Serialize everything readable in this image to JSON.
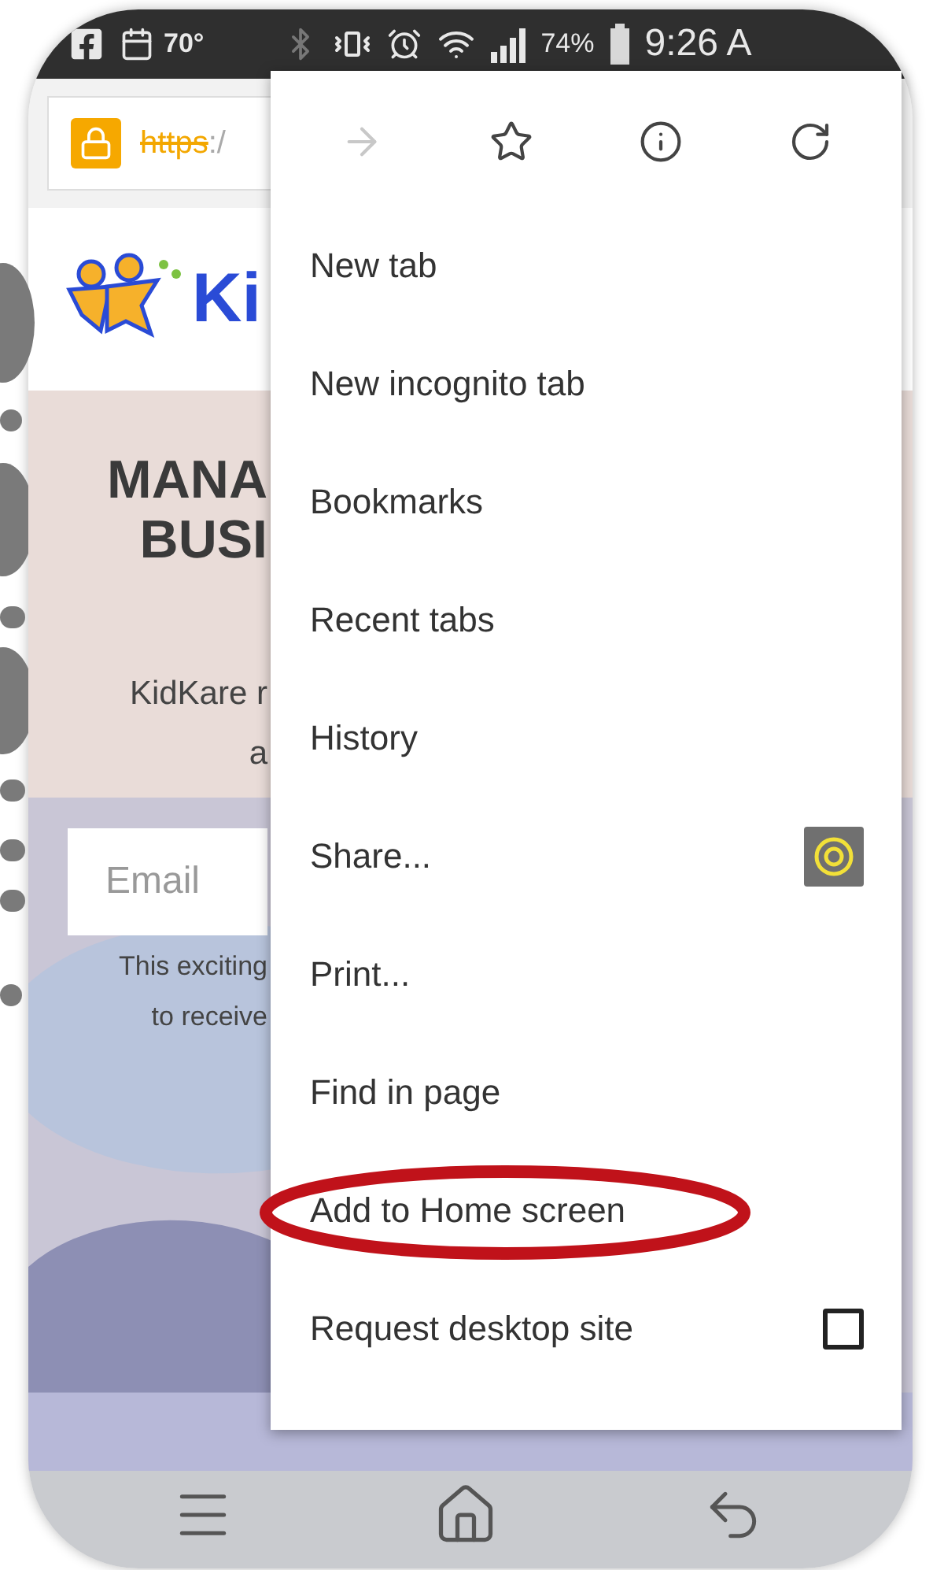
{
  "status_bar": {
    "temperature": "70°",
    "battery": "74%",
    "time": "9:26 A"
  },
  "url_bar": {
    "scheme": "https",
    "rest": ":/"
  },
  "page": {
    "logo_text": "Ki",
    "heading_lines": [
      "MANA",
      "BUSI"
    ],
    "body_lines": [
      "KidKare r",
      "a"
    ],
    "email": {
      "placeholder": "Email"
    },
    "note_lines": [
      "This exciting",
      "to receive"
    ]
  },
  "menu": {
    "toolbar": [
      {
        "kind": "forward",
        "disabled": true
      },
      {
        "kind": "bookmark",
        "disabled": false
      },
      {
        "kind": "info",
        "disabled": false
      },
      {
        "kind": "reload",
        "disabled": false
      }
    ],
    "items": [
      {
        "label": "New tab",
        "kind": "plain",
        "annotated": false
      },
      {
        "label": "New incognito tab",
        "kind": "plain",
        "annotated": false
      },
      {
        "label": "Bookmarks",
        "kind": "plain",
        "annotated": false
      },
      {
        "label": "Recent tabs",
        "kind": "plain",
        "annotated": false
      },
      {
        "label": "History",
        "kind": "plain",
        "annotated": false
      },
      {
        "label": "Share...",
        "kind": "share",
        "annotated": false
      },
      {
        "label": "Print...",
        "kind": "plain",
        "annotated": false
      },
      {
        "label": "Find in page",
        "kind": "plain",
        "annotated": false
      },
      {
        "label": "Add to Home screen",
        "kind": "plain",
        "annotated": true
      },
      {
        "label": "Request desktop site",
        "kind": "checkbox",
        "checked": false,
        "annotated": false
      }
    ]
  }
}
